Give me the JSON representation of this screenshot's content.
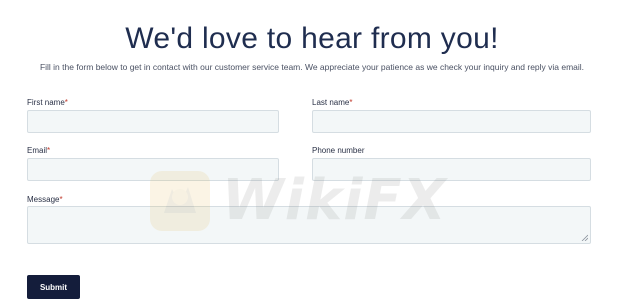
{
  "header": {
    "title": "We'd love to hear from you!",
    "subtitle": "Fill in the form below to get in contact with our customer service team. We appreciate your patience as we check your inquiry and reply via email."
  },
  "form": {
    "first_name": {
      "label": "First name",
      "required_mark": "*",
      "value": ""
    },
    "last_name": {
      "label": "Last name",
      "required_mark": "*",
      "value": ""
    },
    "email": {
      "label": "Email",
      "required_mark": "*",
      "value": ""
    },
    "phone": {
      "label": "Phone number",
      "value": ""
    },
    "message": {
      "label": "Message",
      "required_mark": "*",
      "value": ""
    },
    "submit_label": "Submit"
  },
  "watermark": {
    "text": "WikiFX",
    "icon": "wikifx-logo-icon"
  },
  "colors": {
    "primary_dark": "#141d3b",
    "title": "#1f2d4f",
    "required": "#c0392b",
    "input_bg": "#f3f7f8",
    "input_border": "#d5dde2"
  }
}
